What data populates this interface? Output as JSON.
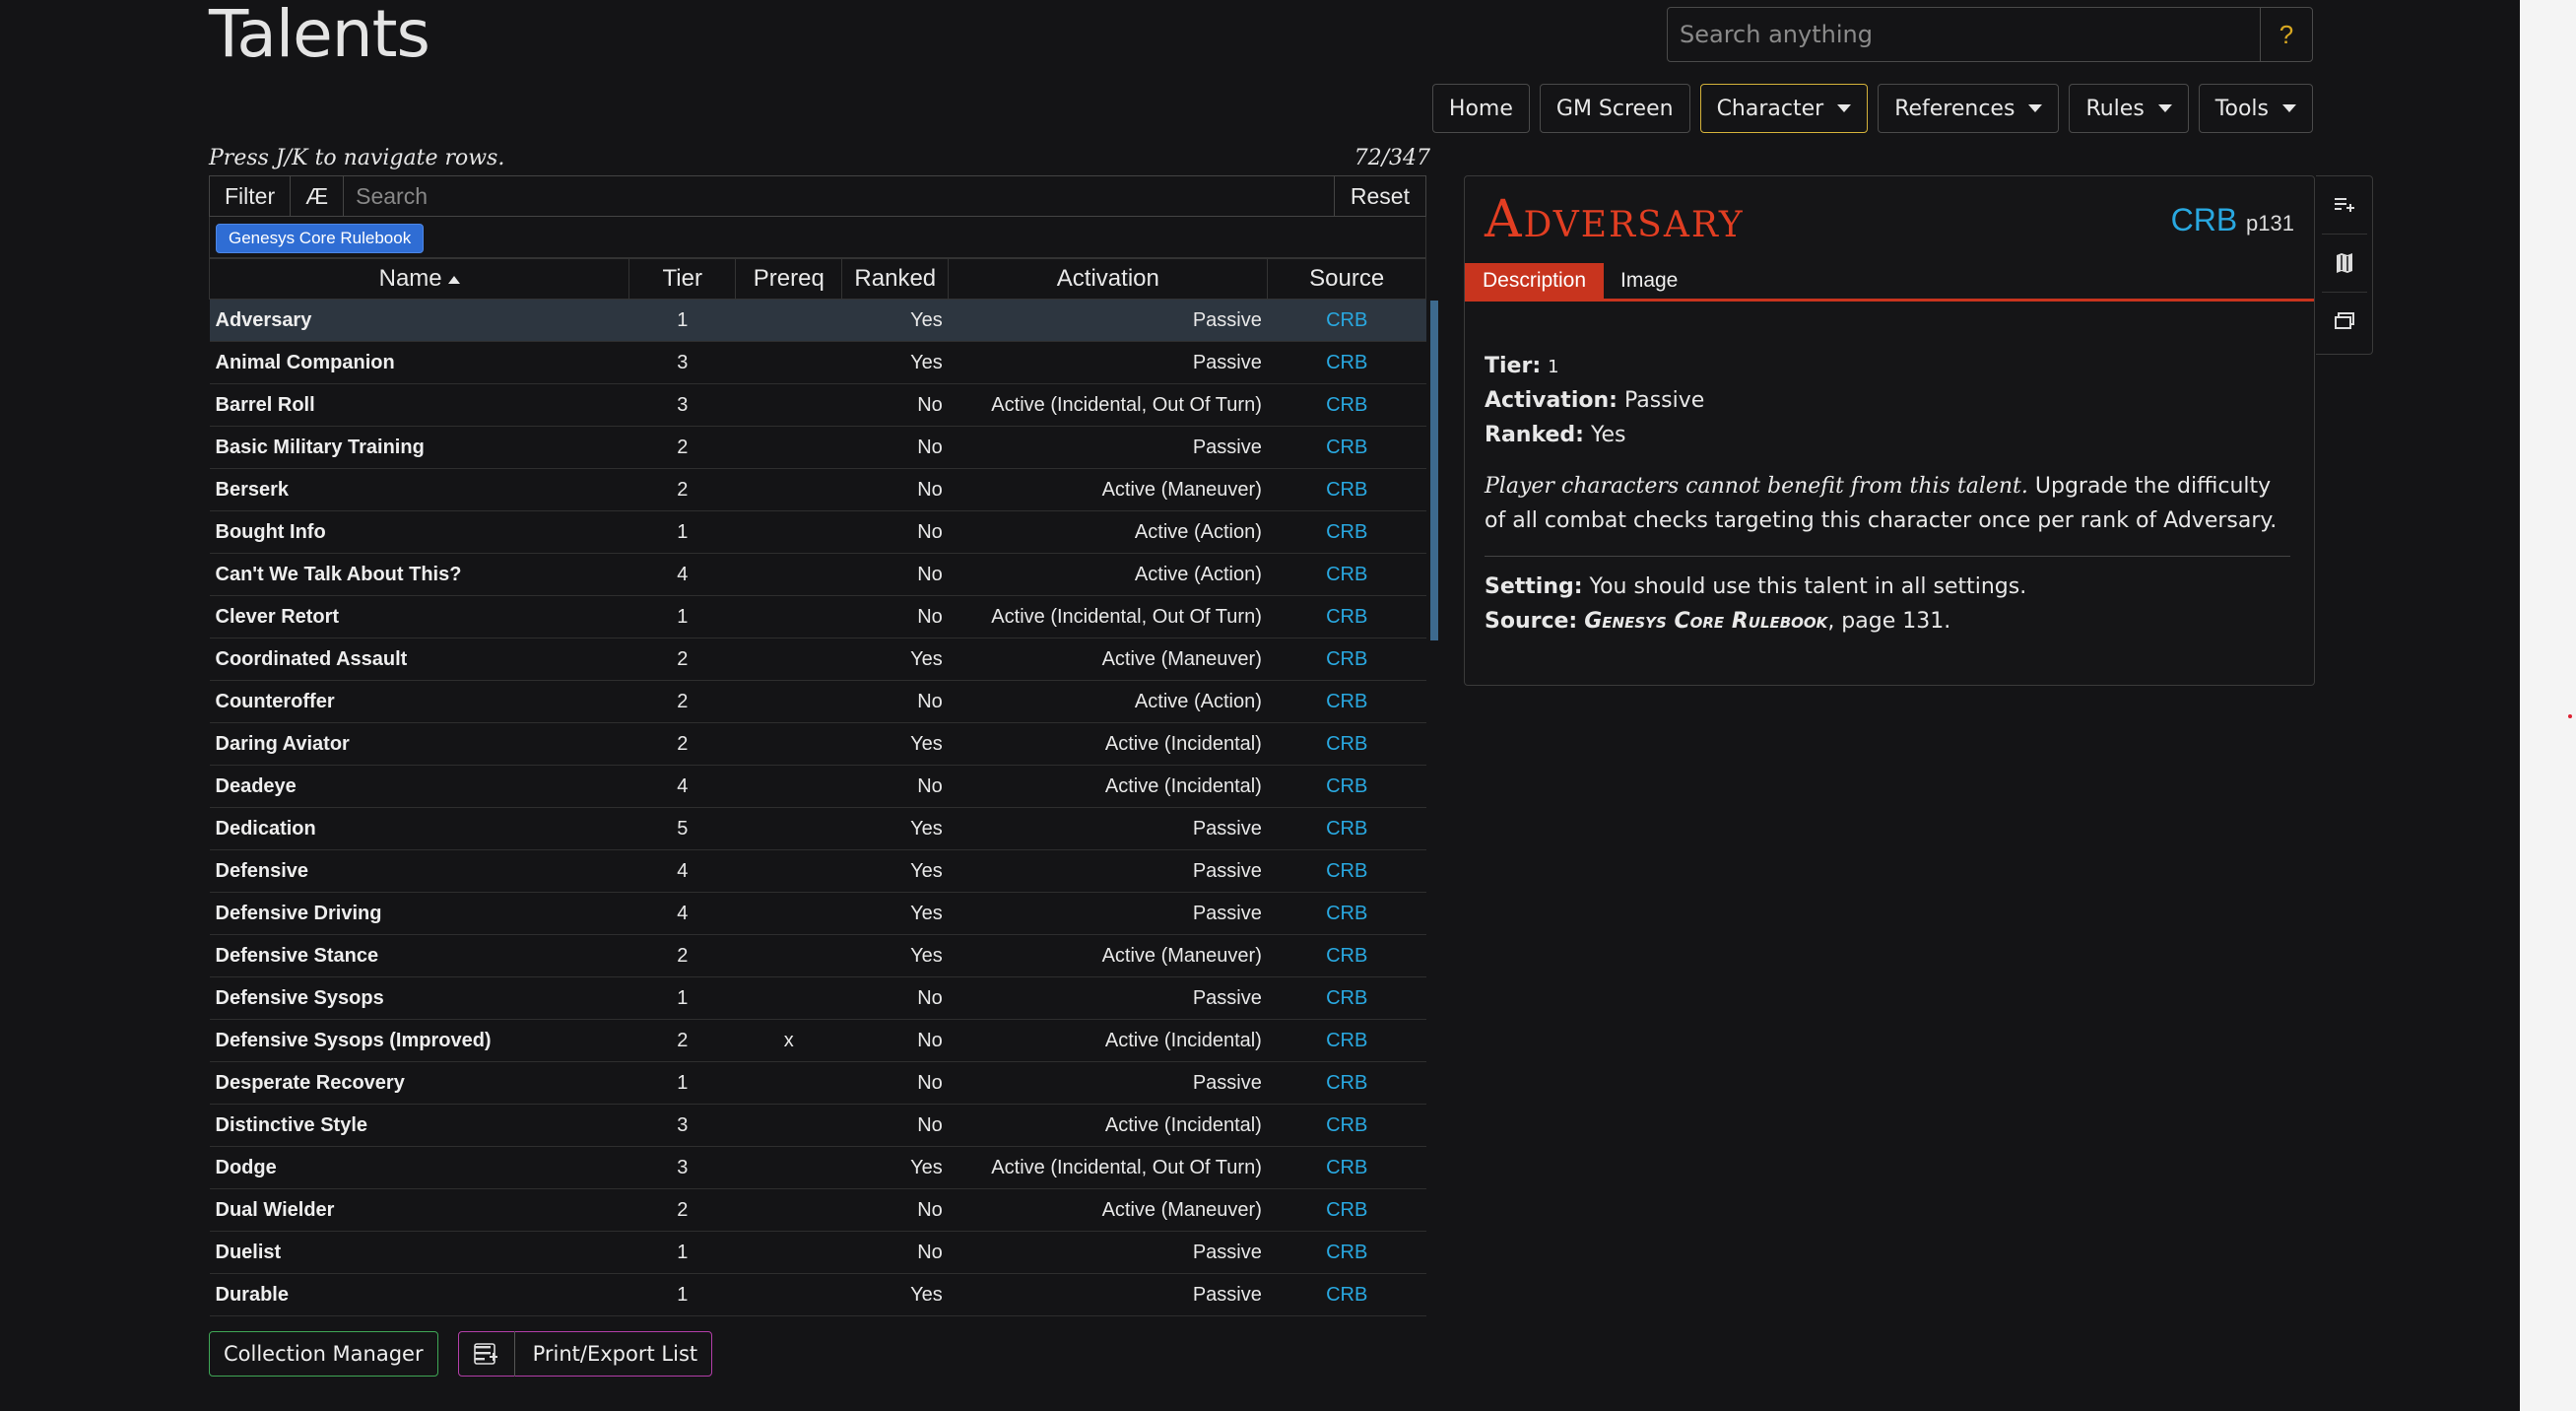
{
  "page": {
    "title": "Talents"
  },
  "omnisearch": {
    "placeholder": "Search anything",
    "help_label": "?"
  },
  "nav": {
    "home": "Home",
    "gm_screen": "GM Screen",
    "character": "Character",
    "references": "References",
    "rules": "Rules",
    "tools": "Tools"
  },
  "list": {
    "hint": "Press J/K to navigate rows.",
    "count": "72/347",
    "filter_label": "Filter",
    "ae_label": "Æ",
    "search_placeholder": "Search",
    "reset_label": "Reset",
    "active_filter_pill": "Genesys Core Rulebook",
    "columns": {
      "name": "Name",
      "tier": "Tier",
      "prereq": "Prereq",
      "ranked": "Ranked",
      "activation": "Activation",
      "source": "Source"
    },
    "rows": [
      {
        "name": "Adversary",
        "tier": "1",
        "prereq": "",
        "ranked": "Yes",
        "activation": "Passive",
        "source": "CRB"
      },
      {
        "name": "Animal Companion",
        "tier": "3",
        "prereq": "",
        "ranked": "Yes",
        "activation": "Passive",
        "source": "CRB"
      },
      {
        "name": "Barrel Roll",
        "tier": "3",
        "prereq": "",
        "ranked": "No",
        "activation": "Active (Incidental, Out Of Turn)",
        "source": "CRB"
      },
      {
        "name": "Basic Military Training",
        "tier": "2",
        "prereq": "",
        "ranked": "No",
        "activation": "Passive",
        "source": "CRB"
      },
      {
        "name": "Berserk",
        "tier": "2",
        "prereq": "",
        "ranked": "No",
        "activation": "Active (Maneuver)",
        "source": "CRB"
      },
      {
        "name": "Bought Info",
        "tier": "1",
        "prereq": "",
        "ranked": "No",
        "activation": "Active (Action)",
        "source": "CRB"
      },
      {
        "name": "Can't We Talk About This?",
        "tier": "4",
        "prereq": "",
        "ranked": "No",
        "activation": "Active (Action)",
        "source": "CRB"
      },
      {
        "name": "Clever Retort",
        "tier": "1",
        "prereq": "",
        "ranked": "No",
        "activation": "Active (Incidental, Out Of Turn)",
        "source": "CRB"
      },
      {
        "name": "Coordinated Assault",
        "tier": "2",
        "prereq": "",
        "ranked": "Yes",
        "activation": "Active (Maneuver)",
        "source": "CRB"
      },
      {
        "name": "Counteroffer",
        "tier": "2",
        "prereq": "",
        "ranked": "No",
        "activation": "Active (Action)",
        "source": "CRB"
      },
      {
        "name": "Daring Aviator",
        "tier": "2",
        "prereq": "",
        "ranked": "Yes",
        "activation": "Active (Incidental)",
        "source": "CRB"
      },
      {
        "name": "Deadeye",
        "tier": "4",
        "prereq": "",
        "ranked": "No",
        "activation": "Active (Incidental)",
        "source": "CRB"
      },
      {
        "name": "Dedication",
        "tier": "5",
        "prereq": "",
        "ranked": "Yes",
        "activation": "Passive",
        "source": "CRB"
      },
      {
        "name": "Defensive",
        "tier": "4",
        "prereq": "",
        "ranked": "Yes",
        "activation": "Passive",
        "source": "CRB"
      },
      {
        "name": "Defensive Driving",
        "tier": "4",
        "prereq": "",
        "ranked": "Yes",
        "activation": "Passive",
        "source": "CRB"
      },
      {
        "name": "Defensive Stance",
        "tier": "2",
        "prereq": "",
        "ranked": "Yes",
        "activation": "Active (Maneuver)",
        "source": "CRB"
      },
      {
        "name": "Defensive Sysops",
        "tier": "1",
        "prereq": "",
        "ranked": "No",
        "activation": "Passive",
        "source": "CRB"
      },
      {
        "name": "Defensive Sysops (Improved)",
        "tier": "2",
        "prereq": "x",
        "ranked": "No",
        "activation": "Active (Incidental)",
        "source": "CRB"
      },
      {
        "name": "Desperate Recovery",
        "tier": "1",
        "prereq": "",
        "ranked": "No",
        "activation": "Passive",
        "source": "CRB"
      },
      {
        "name": "Distinctive Style",
        "tier": "3",
        "prereq": "",
        "ranked": "No",
        "activation": "Active (Incidental)",
        "source": "CRB"
      },
      {
        "name": "Dodge",
        "tier": "3",
        "prereq": "",
        "ranked": "Yes",
        "activation": "Active (Incidental, Out Of Turn)",
        "source": "CRB"
      },
      {
        "name": "Dual Wielder",
        "tier": "2",
        "prereq": "",
        "ranked": "No",
        "activation": "Active (Maneuver)",
        "source": "CRB"
      },
      {
        "name": "Duelist",
        "tier": "1",
        "prereq": "",
        "ranked": "No",
        "activation": "Passive",
        "source": "CRB"
      },
      {
        "name": "Durable",
        "tier": "1",
        "prereq": "",
        "ranked": "Yes",
        "activation": "Passive",
        "source": "CRB"
      }
    ],
    "collection_manager": "Collection Manager",
    "print_export": "Print/Export List"
  },
  "detail": {
    "title": "Adversary",
    "source_abbr": "CRB",
    "page_ref": "p131",
    "tabs": {
      "description": "Description",
      "image": "Image"
    },
    "tier_label": "Tier:",
    "tier_value": "1",
    "activation_label": "Activation:",
    "activation_value": "Passive",
    "ranked_label": "Ranked:",
    "ranked_value": "Yes",
    "desc_italic": "Player characters cannot benefit from this talent.",
    "desc_rest": " Upgrade the difficulty of all combat checks targeting this character once per rank of Adversary.",
    "setting_label": "Setting:",
    "setting_value": " You should use this talent in all settings.",
    "source_label": "Source:",
    "source_book": "Genesys Core Rulebook",
    "source_page": ", page 131."
  },
  "colors": {
    "accent_red": "#c8341e",
    "link_blue": "#29a8e0",
    "active_nav": "#d4b23a",
    "pill_blue": "#2f6dd4"
  }
}
